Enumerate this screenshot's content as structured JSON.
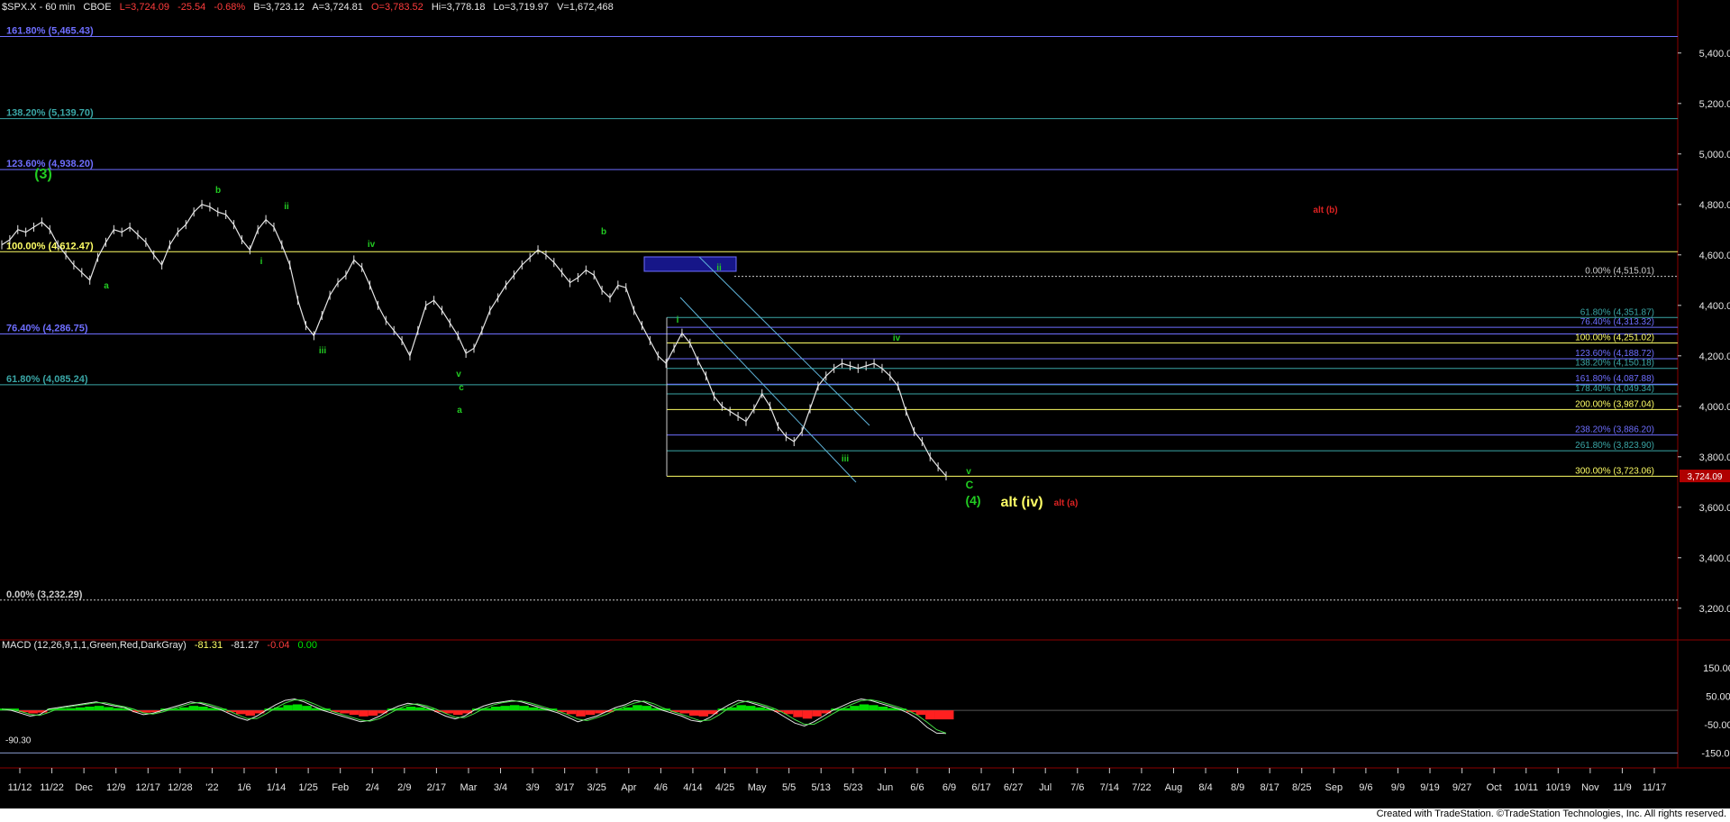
{
  "header": {
    "symbol": "$SPX.X - 60 min",
    "exchange": "CBOE",
    "last": "L=3,724.09",
    "change": "-25.54",
    "change_pct": "-0.68%",
    "bid": "B=3,723.12",
    "ask": "A=3,724.81",
    "open": "O=3,783.52",
    "high": "Hi=3,778.18",
    "low": "Lo=3,719.97",
    "volume": "V=1,672,468"
  },
  "macd_header": {
    "label": "MACD (12,26,9,1,1,Green,Red,DarkGray)",
    "v1": "-81.31",
    "v2": "-81.27",
    "v3": "-0.04",
    "v4": "0.00"
  },
  "footer": {
    "credit": "Created with TradeStation. ©TradeStation Technologies, Inc. All rights reserved."
  },
  "colors": {
    "background": "#000000",
    "bars": "#e6e6e6",
    "blue_fib": "#6e6eff",
    "green_fib": "#3aa6a6",
    "yellow_fib": "#ffff66",
    "wave_green": "#22cc22",
    "wave_red": "#dd2222",
    "macd_green": "#00dd00",
    "macd_red": "#ff2020"
  },
  "chart_data": [
    {
      "type": "line",
      "title": "$SPX.X - 60 min",
      "y_axis": {
        "ticks": [
          3200,
          3400,
          3600,
          3800,
          4000,
          4200,
          4400,
          4600,
          4800,
          5000,
          5200,
          5400
        ],
        "tick_labels": [
          "3,200.00",
          "3,400.00",
          "3,600.00",
          "3,800.00",
          "4,000.00",
          "4,200.00",
          "4,400.00",
          "4,600.00",
          "4,800.00",
          "5,000.00",
          "5,200.00",
          "5,400.00"
        ],
        "ylim": [
          3110,
          5560
        ]
      },
      "x_axis": {
        "tick_labels": [
          "11/12",
          "11/22",
          "Dec",
          "12/9",
          "12/17",
          "12/28",
          "'22",
          "1/6",
          "1/14",
          "1/25",
          "Feb",
          "2/4",
          "2/9",
          "2/17",
          "Mar",
          "3/4",
          "3/9",
          "3/17",
          "3/25",
          "Apr",
          "4/6",
          "4/14",
          "4/25",
          "May",
          "5/5",
          "5/13",
          "5/23",
          "Jun",
          "6/6",
          "6/9",
          "6/17",
          "6/27",
          "Jul",
          "7/6",
          "7/14",
          "7/22",
          "Aug",
          "8/4",
          "8/9",
          "8/17",
          "8/25",
          "Sep",
          "9/6",
          "9/9",
          "9/19",
          "9/27",
          "Oct",
          "10/11",
          "10/19",
          "Nov",
          "11/9",
          "11/17"
        ]
      },
      "series": [
        {
          "values": [
            4640,
            4660,
            4700,
            4690,
            4710,
            4730,
            4700,
            4640,
            4600,
            4560,
            4530,
            4500,
            4590,
            4650,
            4700,
            4690,
            4710,
            4680,
            4650,
            4600,
            4560,
            4640,
            4690,
            4720,
            4770,
            4800,
            4790,
            4770,
            4760,
            4720,
            4660,
            4620,
            4700,
            4740,
            4710,
            4640,
            4560,
            4420,
            4320,
            4280,
            4360,
            4440,
            4490,
            4520,
            4580,
            4550,
            4480,
            4400,
            4340,
            4300,
            4260,
            4200,
            4300,
            4400,
            4420,
            4380,
            4330,
            4280,
            4210,
            4230,
            4300,
            4380,
            4430,
            4480,
            4520,
            4560,
            4590,
            4620,
            4600,
            4570,
            4530,
            4490,
            4510,
            4540,
            4520,
            4460,
            4430,
            4480,
            4470,
            4380,
            4320,
            4260,
            4200,
            4170,
            4230,
            4290,
            4250,
            4180,
            4120,
            4040,
            4000,
            3980,
            3960,
            3940,
            3990,
            4050,
            4000,
            3920,
            3880,
            3860,
            3900,
            3990,
            4080,
            4120,
            4150,
            4170,
            4160,
            4150,
            4160,
            4170,
            4150,
            4120,
            4080,
            3980,
            3900,
            3860,
            3800,
            3760,
            3724.09
          ]
        }
      ],
      "fib_levels_left": [
        {
          "label": "161.80% (5,465.43)",
          "value": 5465.43,
          "color": "blue"
        },
        {
          "label": "138.20% (5,139.70)",
          "value": 5139.7,
          "color": "green"
        },
        {
          "label": "123.60% (4,938.20)",
          "value": 4938.2,
          "color": "blue"
        },
        {
          "label": "100.00% (4,612.47)",
          "value": 4612.47,
          "color": "yellow"
        },
        {
          "label": "76.40% (4,286.75)",
          "value": 4286.75,
          "color": "blue"
        },
        {
          "label": "61.80% (4,085.24)",
          "value": 4085.24,
          "color": "green"
        },
        {
          "label": "0.00% (3,232.29)",
          "value": 3232.29,
          "color": "white"
        }
      ],
      "fib_levels_right": [
        {
          "label": "0.00% (4,515.01)",
          "value": 4515.01,
          "color": "white"
        },
        {
          "label": "61.80% (4,351.87)",
          "value": 4351.87,
          "color": "green"
        },
        {
          "label": "76.40% (4,313.32)",
          "value": 4313.32,
          "color": "blue"
        },
        {
          "label": "100.00% (4,251.02)",
          "value": 4251.02,
          "color": "yellow"
        },
        {
          "label": "123.60% (4,188.72)",
          "value": 4188.72,
          "color": "blue"
        },
        {
          "label": "138.20% (4,150.18)",
          "value": 4150.18,
          "color": "green"
        },
        {
          "label": "161.80% (4,087.88)",
          "value": 4087.88,
          "color": "blue"
        },
        {
          "label": "178.40% (4,049.34)",
          "value": 4049.34,
          "color": "green"
        },
        {
          "label": "200.00% (3,987.04)",
          "value": 3987.04,
          "color": "yellow"
        },
        {
          "label": "238.20% (3,886.20)",
          "value": 3886.2,
          "color": "blue"
        },
        {
          "label": "261.80% (3,823.90)",
          "value": 3823.9,
          "color": "green"
        },
        {
          "label": "300.00% (3,723.06)",
          "value": 3723.06,
          "color": "yellow"
        }
      ],
      "last_price_tag": "3,724.09",
      "wave_labels": [
        {
          "text": "(3)",
          "color": "green"
        },
        {
          "text": "a",
          "color": "green"
        },
        {
          "text": "b",
          "color": "green"
        },
        {
          "text": "i",
          "color": "green"
        },
        {
          "text": "ii",
          "color": "green"
        },
        {
          "text": "iii",
          "color": "green"
        },
        {
          "text": "iv",
          "color": "green"
        },
        {
          "text": "v",
          "color": "green"
        },
        {
          "text": "c",
          "color": "green"
        },
        {
          "text": "a",
          "color": "green"
        },
        {
          "text": "b",
          "color": "green"
        },
        {
          "text": "i",
          "color": "green"
        },
        {
          "text": "ii",
          "color": "green"
        },
        {
          "text": "iii",
          "color": "green"
        },
        {
          "text": "iv",
          "color": "green"
        },
        {
          "text": "v",
          "color": "green"
        },
        {
          "text": "C",
          "color": "green"
        },
        {
          "text": "(4)",
          "color": "green"
        },
        {
          "text": "alt (iv)",
          "color": "yellow"
        },
        {
          "text": "alt (a)",
          "color": "red"
        },
        {
          "text": "alt (b)",
          "color": "red"
        }
      ]
    },
    {
      "type": "line",
      "title": "MACD (12,26,9,1,1,Green,Red,DarkGray)",
      "y_axis": {
        "ticks": [
          150,
          50,
          -50,
          -150
        ],
        "tick_labels": [
          "150.00",
          "50.00",
          "-50.00",
          "-150.00"
        ],
        "ylim": [
          -190,
          210
        ]
      },
      "low_label": "-90.30",
      "series": [
        {
          "values": [
            5,
            0,
            -10,
            -20,
            -15,
            5,
            10,
            15,
            20,
            25,
            30,
            22,
            15,
            10,
            -5,
            -15,
            -10,
            0,
            10,
            20,
            30,
            25,
            15,
            5,
            -10,
            -25,
            -35,
            -20,
            0,
            20,
            35,
            40,
            30,
            15,
            0,
            -10,
            -20,
            -30,
            -40,
            -35,
            -20,
            0,
            15,
            25,
            20,
            10,
            -5,
            -20,
            -30,
            -20,
            0,
            15,
            25,
            30,
            35,
            30,
            20,
            10,
            0,
            -10,
            -25,
            -40,
            -30,
            -20,
            -5,
            10,
            20,
            35,
            30,
            15,
            0,
            -10,
            -20,
            -35,
            -40,
            -25,
            0,
            20,
            35,
            30,
            20,
            10,
            -5,
            -25,
            -45,
            -55,
            -40,
            -20,
            0,
            15,
            30,
            40,
            35,
            25,
            15,
            5,
            -10,
            -30,
            -60,
            -80,
            -81.31
          ]
        }
      ]
    }
  ]
}
